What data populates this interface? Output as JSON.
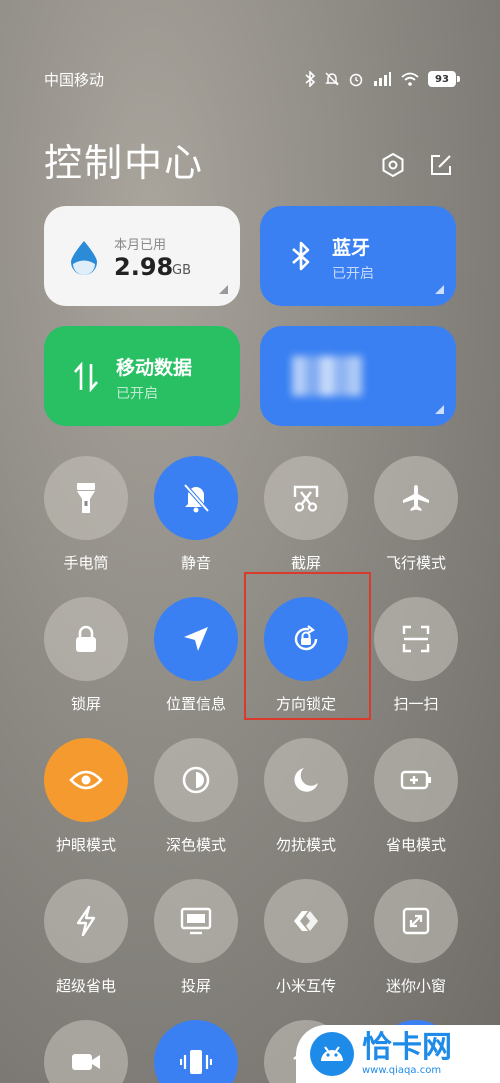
{
  "status": {
    "carrier": "中国移动",
    "battery": "93"
  },
  "header": {
    "title": "控制中心"
  },
  "tiles": {
    "data": {
      "label": "本月已用",
      "value": "2.98",
      "unit": "GB"
    },
    "bluetooth": {
      "title": "蓝牙",
      "status": "已开启"
    },
    "mobile": {
      "title": "移动数据",
      "status": "已开启"
    },
    "wifi": {
      "title": "",
      "status": ""
    }
  },
  "toggles": [
    {
      "label": "手电筒",
      "icon": "flashlight-icon",
      "on": false
    },
    {
      "label": "静音",
      "icon": "mute-bell-icon",
      "on": true
    },
    {
      "label": "截屏",
      "icon": "screenshot-icon",
      "on": false
    },
    {
      "label": "飞行模式",
      "icon": "airplane-icon",
      "on": false
    },
    {
      "label": "锁屏",
      "icon": "lock-icon",
      "on": false
    },
    {
      "label": "位置信息",
      "icon": "location-icon",
      "on": true
    },
    {
      "label": "方向锁定",
      "icon": "rotation-lock-icon",
      "on": true
    },
    {
      "label": "扫一扫",
      "icon": "scan-icon",
      "on": false
    },
    {
      "label": "护眼模式",
      "icon": "eye-icon",
      "on": true
    },
    {
      "label": "深色模式",
      "icon": "dark-mode-icon",
      "on": false
    },
    {
      "label": "勿扰模式",
      "icon": "moon-icon",
      "on": false
    },
    {
      "label": "省电模式",
      "icon": "battery-saver-icon",
      "on": false
    },
    {
      "label": "超级省电",
      "icon": "bolt-icon",
      "on": false
    },
    {
      "label": "投屏",
      "icon": "cast-screen-icon",
      "on": false
    },
    {
      "label": "小米互传",
      "icon": "share-icon",
      "on": false
    },
    {
      "label": "迷你小窗",
      "icon": "mini-window-icon",
      "on": false
    }
  ],
  "watermark": {
    "name": "恰卡网",
    "url": "www.qiaqa.com"
  },
  "colors": {
    "accent": "#3a80f2",
    "green": "#29c064",
    "orange": "#f59a2e",
    "highlight": "#d93a2c"
  }
}
